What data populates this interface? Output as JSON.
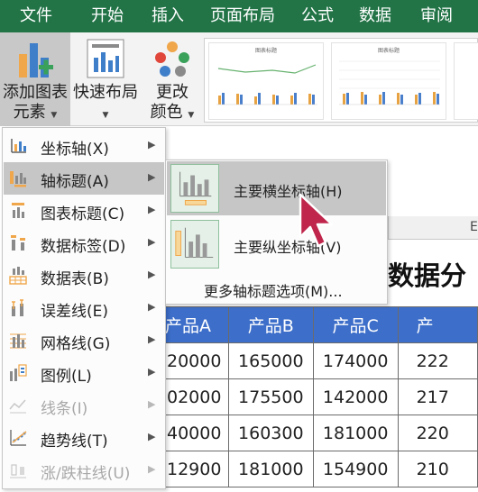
{
  "tabs": [
    "文件",
    "开始",
    "插入",
    "页面布局",
    "公式",
    "数据",
    "审阅"
  ],
  "ribbon": {
    "add_chart_element": {
      "line1": "添加图表",
      "line2": "元素"
    },
    "quick_layout": {
      "line1": "快速布局"
    },
    "change_colors": {
      "line1": "更改",
      "line2": "颜色"
    },
    "style_thumb_titles": [
      "图表标题",
      "图表标题"
    ]
  },
  "menu": {
    "items": [
      {
        "label": "坐标轴(X)",
        "icon": "axes-icon",
        "disabled": false
      },
      {
        "label": "轴标题(A)",
        "icon": "axis-title-icon",
        "disabled": false,
        "selected": true
      },
      {
        "label": "图表标题(C)",
        "icon": "chart-title-icon",
        "disabled": false
      },
      {
        "label": "数据标签(D)",
        "icon": "data-labels-icon",
        "disabled": false
      },
      {
        "label": "数据表(B)",
        "icon": "data-table-icon",
        "disabled": false
      },
      {
        "label": "误差线(E)",
        "icon": "error-bars-icon",
        "disabled": false
      },
      {
        "label": "网格线(G)",
        "icon": "gridlines-icon",
        "disabled": false
      },
      {
        "label": "图例(L)",
        "icon": "legend-icon",
        "disabled": false
      },
      {
        "label": "线条(I)",
        "icon": "lines-icon",
        "disabled": true
      },
      {
        "label": "趋势线(T)",
        "icon": "trendline-icon",
        "disabled": false
      },
      {
        "label": "涨/跌柱线(U)",
        "icon": "updown-bars-icon",
        "disabled": true
      }
    ]
  },
  "submenu": {
    "items": [
      {
        "label": "主要横坐标轴(H)",
        "selected": true
      },
      {
        "label": "主要纵坐标轴(V)",
        "selected": false
      }
    ],
    "more": "更多轴标题选项(M)..."
  },
  "sheet": {
    "column_header": "E",
    "title_fragment": "数据分",
    "table": {
      "headers": [
        "产品A",
        "产品B",
        "产品C",
        "产"
      ],
      "rows": [
        [
          "20000",
          "165000",
          "174000",
          "222"
        ],
        [
          "02000",
          "175500",
          "142000",
          "217"
        ],
        [
          "40000",
          "160300",
          "181000",
          "220"
        ],
        [
          "12900",
          "181000",
          "154900",
          "210"
        ]
      ]
    }
  },
  "colors": {
    "tab_bar": "#227447",
    "table_header": "#3d6ec9",
    "highlight": "#c6c6c6",
    "cursor": "#c0254b"
  }
}
